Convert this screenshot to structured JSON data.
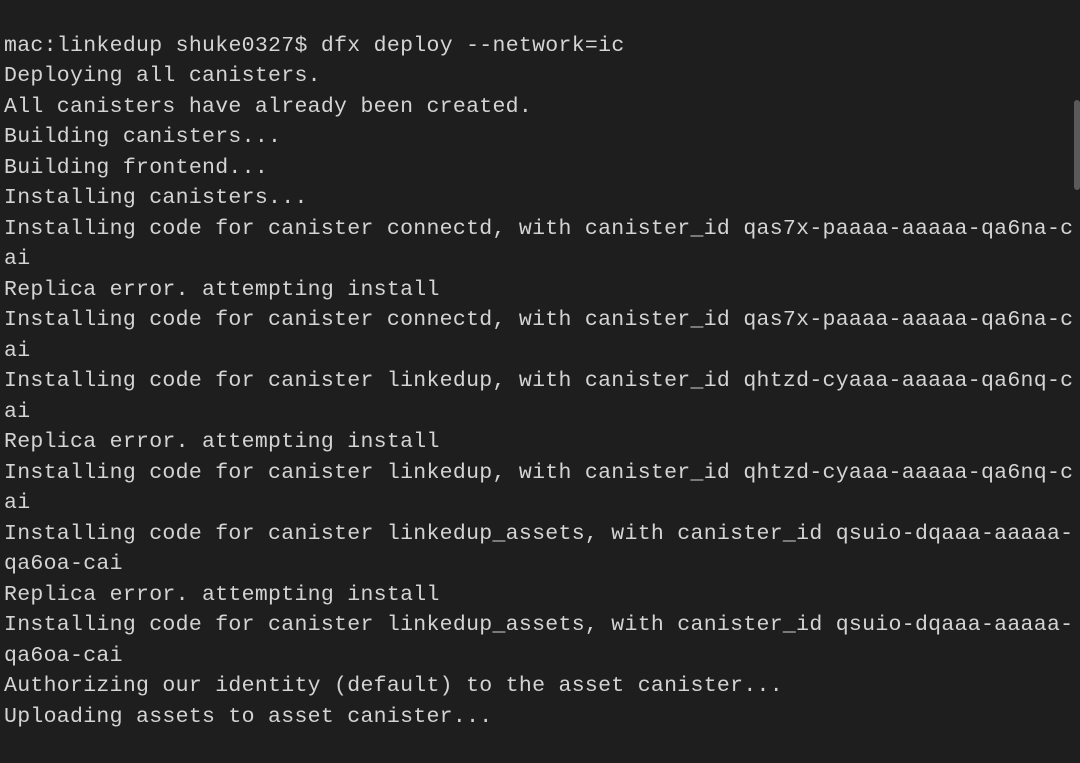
{
  "terminal": {
    "prompt": {
      "host": "mac",
      "dir": "linkedup",
      "user": "shuke0327",
      "symbol": "$",
      "command": "dfx deploy --network=ic"
    },
    "lines": [
      "Deploying all canisters.",
      "All canisters have already been created.",
      "Building canisters...",
      "Building frontend...",
      "Installing canisters...",
      "Installing code for canister connectd, with canister_id qas7x-paaaa-aaaaa-qa6na-cai",
      "Replica error. attempting install",
      "Installing code for canister connectd, with canister_id qas7x-paaaa-aaaaa-qa6na-cai",
      "Installing code for canister linkedup, with canister_id qhtzd-cyaaa-aaaaa-qa6nq-cai",
      "Replica error. attempting install",
      "Installing code for canister linkedup, with canister_id qhtzd-cyaaa-aaaaa-qa6nq-cai",
      "Installing code for canister linkedup_assets, with canister_id qsuio-dqaaa-aaaaa-qa6oa-cai",
      "Replica error. attempting install",
      "Installing code for canister linkedup_assets, with canister_id qsuio-dqaaa-aaaaa-qa6oa-cai",
      "Authorizing our identity (default) to the asset canister...",
      "Uploading assets to asset canister..."
    ]
  }
}
